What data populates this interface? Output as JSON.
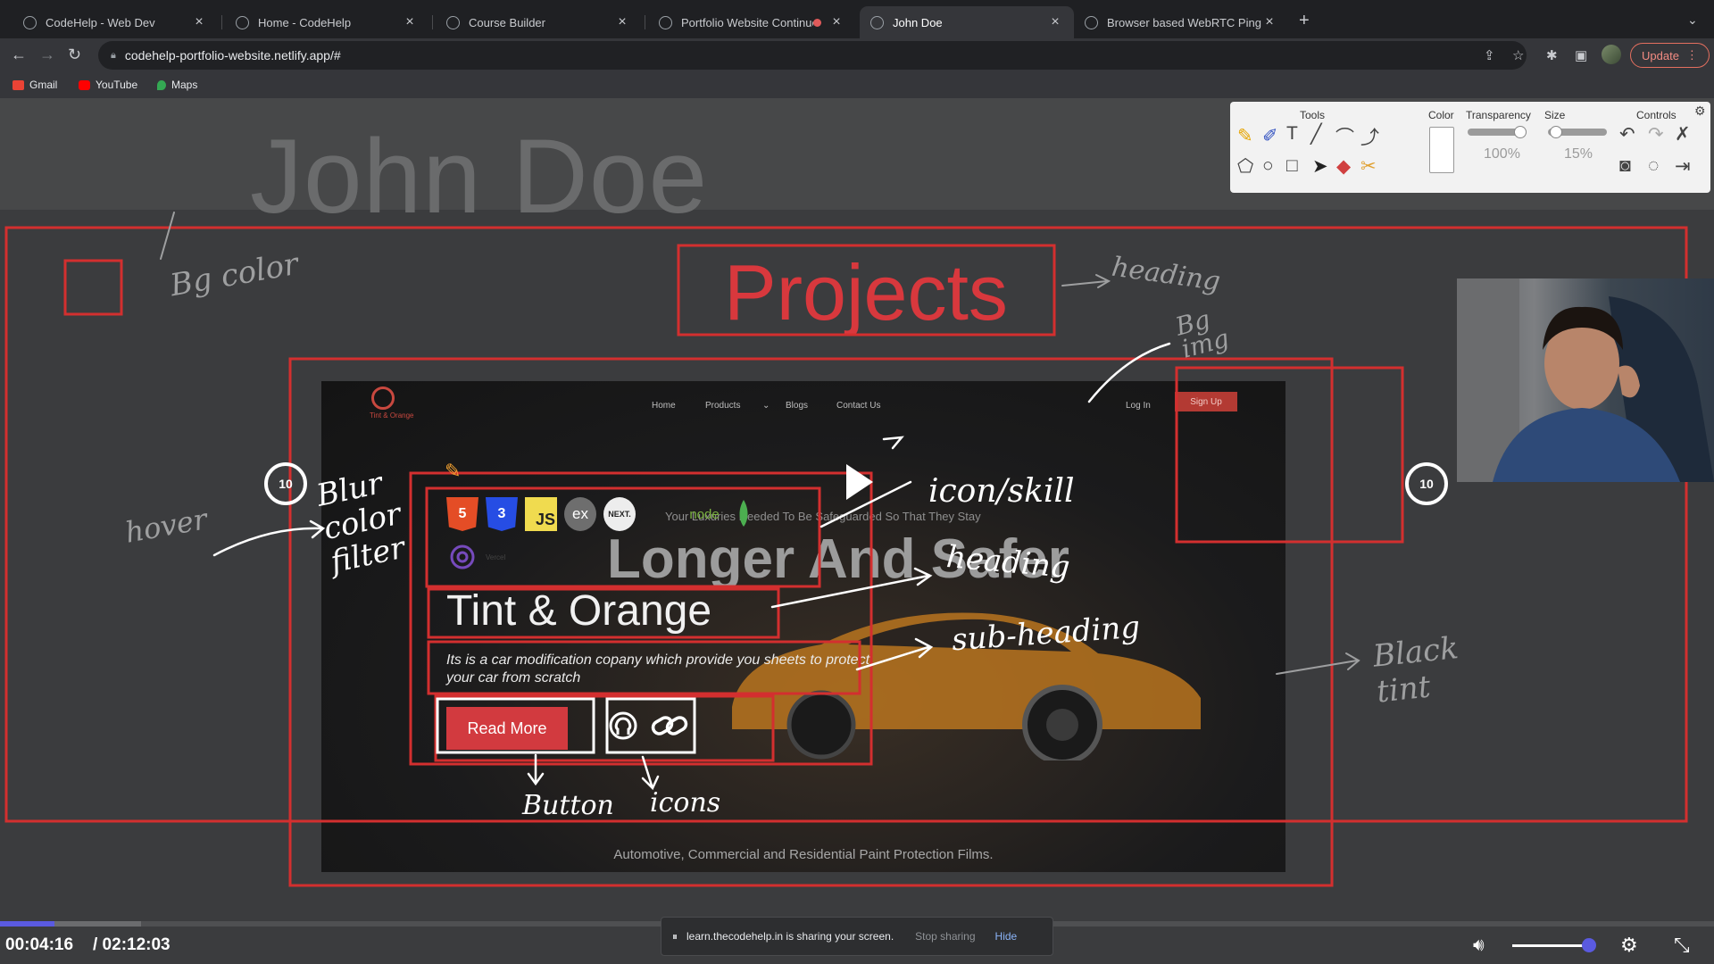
{
  "tabs": [
    {
      "label": "CodeHelp - Web Dev"
    },
    {
      "label": "Home - CodeHelp"
    },
    {
      "label": "Course Builder"
    },
    {
      "label": "Portfolio Website Continue"
    },
    {
      "label": "John Doe"
    },
    {
      "label": "Browser based WebRTC Ping T"
    }
  ],
  "address": {
    "url": "codehelp-portfolio-website.netlify.app/#",
    "update_label": "Update"
  },
  "bookmarks": [
    {
      "label": "Gmail"
    },
    {
      "label": "YouTube"
    },
    {
      "label": "Maps"
    }
  ],
  "page": {
    "name": "John Doe",
    "section_title": "Projects",
    "project": {
      "title": "Tint & Orange",
      "description": "Its is a car modification copany which provide you sheets to protect your car from scratch",
      "button": "Read More",
      "skills": [
        "5",
        "3",
        "JS",
        "ex",
        "NEXT.",
        "",
        "node",
        "",
        ""
      ]
    },
    "preview": {
      "brand": "Tint & Orange",
      "nav": [
        "Home",
        "Products",
        "Blogs",
        "Contact Us"
      ],
      "login": "Log In",
      "signup": "Sign Up",
      "tagline": "Your Luxuries Needed To Be Safeguarded So That They Stay",
      "hero": "Longer And Safer",
      "bottom_text": "Automotive, Commercial and Residential Paint Protection Films.",
      "vercel": "Vercel"
    }
  },
  "annotations": {
    "bg_color": "Bg color",
    "heading": "heading",
    "bg_img": "Bg img",
    "hover": "hover",
    "blur_color_filter": "Blur color filter",
    "icon_skill": "icon/skill",
    "heading2": "heading",
    "subheading": "sub-heading",
    "black_tint": "Black tint",
    "button": "Button",
    "icons": "icons"
  },
  "draw_panel": {
    "tools_label": "Tools",
    "color_label": "Color",
    "transparency_label": "Transparency",
    "transparency_value": "100%",
    "size_label": "Size",
    "size_value": "15%",
    "controls_label": "Controls"
  },
  "player": {
    "skip_back": "10",
    "skip_forward": "10",
    "current_time": "00:04:16",
    "total_time": "/ 02:12:03",
    "progress_fraction": 0.032
  },
  "share": {
    "message": "learn.thecodehelp.in is sharing your screen.",
    "stop": "Stop sharing",
    "hide": "Hide"
  },
  "colors": {
    "annotation_red": "#d32f2f",
    "accent": "#5a5ae0",
    "button_red": "#d23a3f"
  }
}
